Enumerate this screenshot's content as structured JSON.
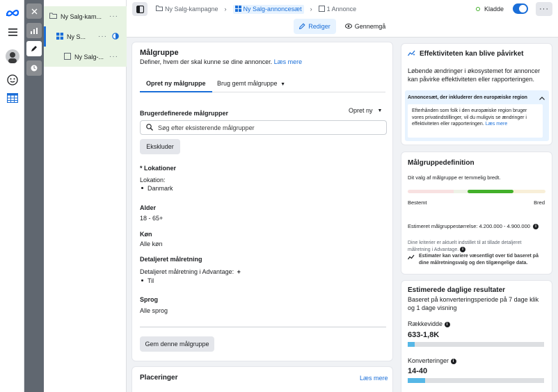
{
  "tree": {
    "campaign": "Ny Salg-kam...",
    "adset": "Ny S...",
    "ad": "Ny Salg-..."
  },
  "topbar": {
    "crumb_campaign": "Ny Salg-kampagne",
    "crumb_adset": "Ny Salg-annoncesæt",
    "crumb_ad": "1 Annonce",
    "status": "Kladde",
    "edit": "Rediger",
    "review": "Gennemgå"
  },
  "audience": {
    "title": "Målgruppe",
    "desc": "Definer, hvem der skal kunne se dine annoncer.",
    "learn_more": "Læs mere",
    "tab_create": "Opret ny målgruppe",
    "tab_saved": "Brug gemt målgruppe",
    "custom_label": "Brugerdefinerede målgrupper",
    "create_new": "Opret ny",
    "search_placeholder": "Søg efter eksisterende målgrupper",
    "exclude": "Ekskluder",
    "locations_label": "* Lokationer",
    "location_sub": "Lokation:",
    "location_value": "Danmark",
    "age_label": "Alder",
    "age_value": "18 - 65+",
    "gender_label": "Køn",
    "gender_value": "Alle køn",
    "detailed_label": "Detaljeret målretning",
    "detailed_sub": "Detaljeret målretning i Advantage:",
    "detailed_plus": "+",
    "detailed_value": "Til",
    "lang_label": "Sprog",
    "lang_value": "Alle sprog",
    "save_button": "Gem denne målgruppe"
  },
  "placements": {
    "title": "Placeringer",
    "learn_more": "Læs mere"
  },
  "effect": {
    "title": "Effektiviteten kan blive påvirket",
    "body": "Løbende ændringer i økosystemet for annoncer kan påvirke effektiviteten eller rapporteringen.",
    "accordion_title": "Annoncesæt, der inkluderer den europæiske region",
    "accordion_body": "Efterhånden som folk i den europæiske region bruger vores privatindstillinger, vil du muligvis se ændringer i effektiviteten eller rapporteringen.",
    "learn_more": "Læs mere"
  },
  "definition": {
    "title": "Målgruppedefinition",
    "desc": "Dit valg af målgruppe er temmelig bredt.",
    "gauge_level": 0.77,
    "left": "Bestemt",
    "right": "Bred",
    "size": "Estimeret målgruppestørrelse: 4.200.000 - 4.900.000",
    "note": "Dine kriterier er aktuelt indstillet til at tillade detaljeret målretning i Advantage.",
    "variance": "Estimater kan variere væsentligt over tid baseret på dine målretningsvalg og den tilgængelige data."
  },
  "results": {
    "title": "Estimerede daglige resultater",
    "desc": "Baseret på konverteringsperiode på 7 dage klik og 1 dage visning",
    "reach_label": "Rækkevidde",
    "reach_value": "633-1,8K",
    "reach_fill": 0.05,
    "conv_label": "Konverteringer",
    "conv_value": "14-40",
    "conv_fill": 0.13
  },
  "colors": {
    "accent": "#1a6ed8",
    "gauge_green": "#43b02a",
    "progress": "#56b7e6"
  }
}
